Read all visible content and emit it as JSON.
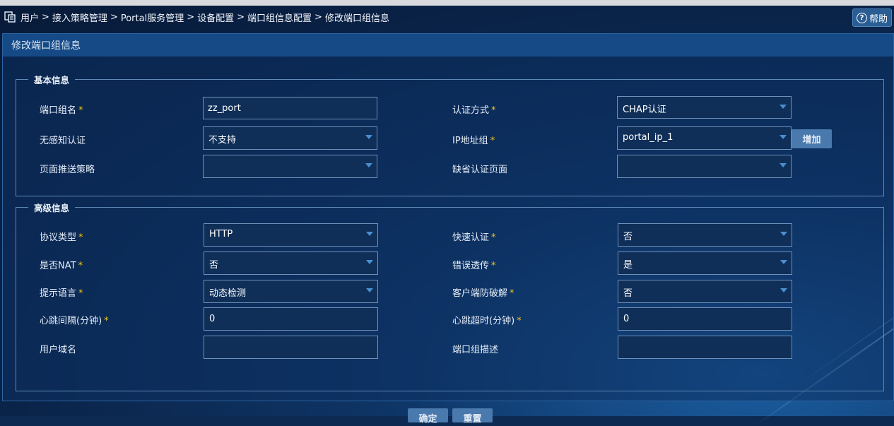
{
  "breadcrumb": {
    "items": [
      "用户",
      "接入策略管理",
      "Portal服务管理",
      "设备配置",
      "端口组信息配置",
      "修改端口组信息"
    ],
    "separator": ">"
  },
  "help": {
    "label": "帮助"
  },
  "panel": {
    "title": "修改端口组信息"
  },
  "basic": {
    "legend": "基本信息",
    "port_group_name": {
      "label": "端口组名",
      "value": "zz_port"
    },
    "auth_method": {
      "label": "认证方式",
      "value": "CHAP认证"
    },
    "seamless_auth": {
      "label": "无感知认证",
      "value": "不支持"
    },
    "ip_group": {
      "label": "IP地址组",
      "value": "portal_ip_1"
    },
    "add_label": "增加",
    "page_push_policy": {
      "label": "页面推送策略",
      "value": ""
    },
    "default_auth_page": {
      "label": "缺省认证页面",
      "value": ""
    }
  },
  "advanced": {
    "legend": "高级信息",
    "protocol": {
      "label": "协议类型",
      "value": "HTTP"
    },
    "quick_auth": {
      "label": "快速认证",
      "value": "否"
    },
    "nat": {
      "label": "是否NAT",
      "value": "否"
    },
    "error_passthrough": {
      "label": "错误透传",
      "value": "是"
    },
    "language": {
      "label": "提示语言",
      "value": "动态检测"
    },
    "anti_crack": {
      "label": "客户端防破解",
      "value": "否"
    },
    "heartbeat_interval": {
      "label": "心跳间隔(分钟)",
      "value": "0"
    },
    "heartbeat_timeout": {
      "label": "心跳超时(分钟)",
      "value": "0"
    },
    "user_domain": {
      "label": "用户域名",
      "value": ""
    },
    "description": {
      "label": "端口组描述",
      "value": ""
    }
  },
  "buttons": {
    "ok": "确定",
    "reset": "重置"
  },
  "required_mark": "*",
  "colors": {
    "accent": "#164a86",
    "required": "#f0c419",
    "button": "#4a79ad"
  }
}
